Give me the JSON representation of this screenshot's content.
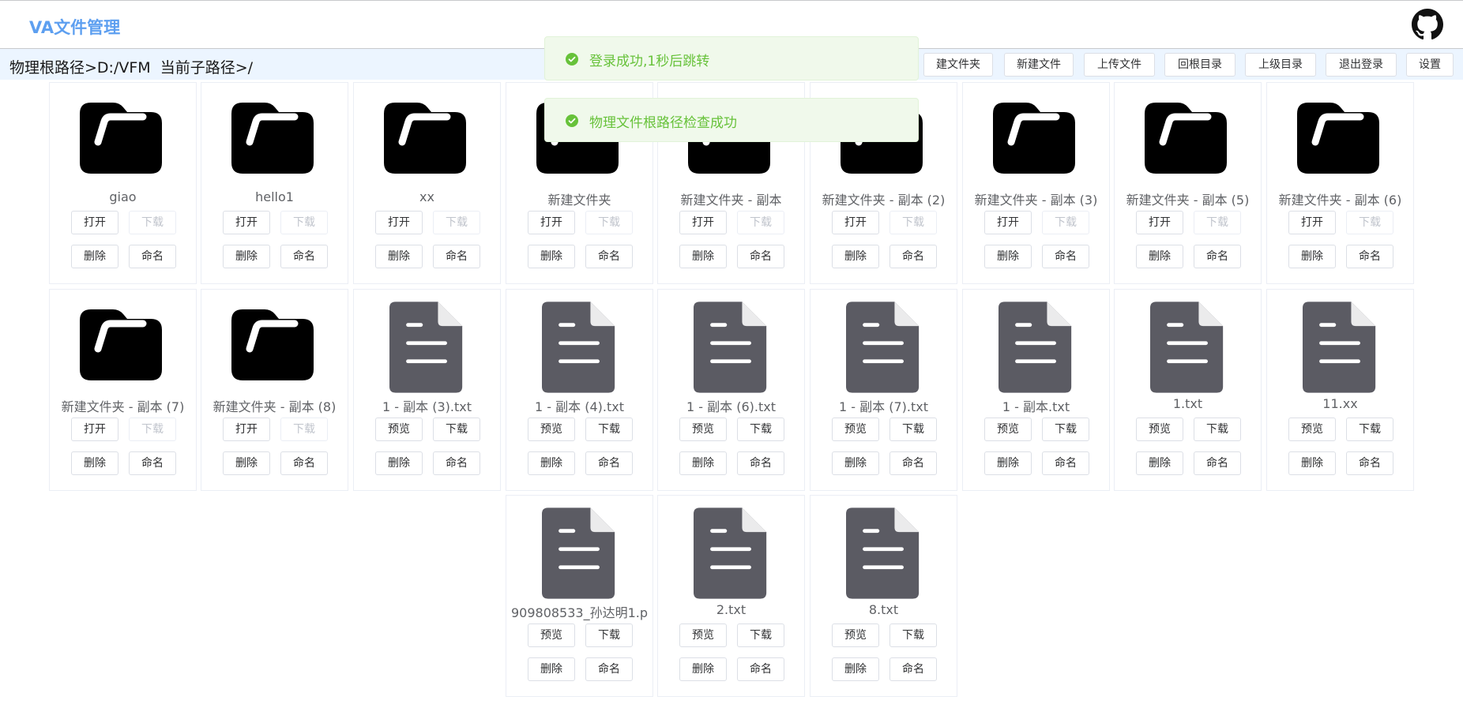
{
  "app": {
    "title": "VA文件管理"
  },
  "header": {
    "github_icon": "github-icon"
  },
  "toolbar": {
    "path": "物理根路径>D:/VFM  当前子路径>/",
    "buttons": [
      "建文件夹",
      "新建文件",
      "上传文件",
      "回根目录",
      "上级目录",
      "退出登录",
      "设置"
    ]
  },
  "toasts": [
    {
      "icon": "check-circle-icon",
      "message": "登录成功,1秒后跳转"
    },
    {
      "icon": "check-circle-icon",
      "message": "物理文件根路径检查成功"
    }
  ],
  "colors": {
    "brand": "#5d9ff0",
    "success": "#67c23a",
    "folder": "#000000",
    "file": "#5b5b63"
  },
  "items": [
    {
      "name": "giao",
      "type": "folder",
      "buttons": [
        "打开",
        "下载",
        "删除",
        "命名"
      ],
      "disabled": [
        false,
        true,
        false,
        false
      ]
    },
    {
      "name": "hello1",
      "type": "folder",
      "buttons": [
        "打开",
        "下载",
        "删除",
        "命名"
      ],
      "disabled": [
        false,
        true,
        false,
        false
      ]
    },
    {
      "name": "xx",
      "type": "folder",
      "buttons": [
        "打开",
        "下载",
        "删除",
        "命名"
      ],
      "disabled": [
        false,
        true,
        false,
        false
      ]
    },
    {
      "name": "新建文件夹",
      "type": "folder",
      "buttons": [
        "打开",
        "下载",
        "删除",
        "命名"
      ],
      "disabled": [
        false,
        true,
        false,
        false
      ]
    },
    {
      "name": "新建文件夹 - 副本",
      "type": "folder",
      "buttons": [
        "打开",
        "下载",
        "删除",
        "命名"
      ],
      "disabled": [
        false,
        true,
        false,
        false
      ]
    },
    {
      "name": "新建文件夹 - 副本 (2)",
      "type": "folder",
      "buttons": [
        "打开",
        "下载",
        "删除",
        "命名"
      ],
      "disabled": [
        false,
        true,
        false,
        false
      ]
    },
    {
      "name": "新建文件夹 - 副本 (3)",
      "type": "folder",
      "buttons": [
        "打开",
        "下载",
        "删除",
        "命名"
      ],
      "disabled": [
        false,
        true,
        false,
        false
      ]
    },
    {
      "name": "新建文件夹 - 副本 (5)",
      "type": "folder",
      "buttons": [
        "打开",
        "下载",
        "删除",
        "命名"
      ],
      "disabled": [
        false,
        true,
        false,
        false
      ]
    },
    {
      "name": "新建文件夹 - 副本 (6)",
      "type": "folder",
      "buttons": [
        "打开",
        "下载",
        "删除",
        "命名"
      ],
      "disabled": [
        false,
        true,
        false,
        false
      ]
    },
    {
      "name": "新建文件夹 - 副本 (7)",
      "type": "folder",
      "buttons": [
        "打开",
        "下载",
        "删除",
        "命名"
      ],
      "disabled": [
        false,
        true,
        false,
        false
      ]
    },
    {
      "name": "新建文件夹 - 副本 (8)",
      "type": "folder",
      "buttons": [
        "打开",
        "下载",
        "删除",
        "命名"
      ],
      "disabled": [
        false,
        true,
        false,
        false
      ]
    },
    {
      "name": "1 - 副本 (3).txt",
      "type": "file",
      "buttons": [
        "预览",
        "下载",
        "删除",
        "命名"
      ],
      "disabled": [
        false,
        false,
        false,
        false
      ]
    },
    {
      "name": "1 - 副本 (4).txt",
      "type": "file",
      "buttons": [
        "预览",
        "下载",
        "删除",
        "命名"
      ],
      "disabled": [
        false,
        false,
        false,
        false
      ]
    },
    {
      "name": "1 - 副本 (6).txt",
      "type": "file",
      "buttons": [
        "预览",
        "下载",
        "删除",
        "命名"
      ],
      "disabled": [
        false,
        false,
        false,
        false
      ]
    },
    {
      "name": "1 - 副本 (7).txt",
      "type": "file",
      "buttons": [
        "预览",
        "下载",
        "删除",
        "命名"
      ],
      "disabled": [
        false,
        false,
        false,
        false
      ]
    },
    {
      "name": "1 - 副本.txt",
      "type": "file",
      "buttons": [
        "预览",
        "下载",
        "删除",
        "命名"
      ],
      "disabled": [
        false,
        false,
        false,
        false
      ]
    },
    {
      "name": "1.txt",
      "type": "file",
      "buttons": [
        "预览",
        "下载",
        "删除",
        "命名"
      ],
      "disabled": [
        false,
        false,
        false,
        false
      ]
    },
    {
      "name": "11.xx",
      "type": "file",
      "buttons": [
        "预览",
        "下载",
        "删除",
        "命名"
      ],
      "disabled": [
        false,
        false,
        false,
        false
      ]
    },
    {
      "name": "909808533_孙达明1.p",
      "type": "file",
      "buttons": [
        "预览",
        "下载",
        "删除",
        "命名"
      ],
      "disabled": [
        false,
        false,
        false,
        false
      ]
    },
    {
      "name": "2.txt",
      "type": "file",
      "buttons": [
        "预览",
        "下载",
        "删除",
        "命名"
      ],
      "disabled": [
        false,
        false,
        false,
        false
      ]
    },
    {
      "name": "8.txt",
      "type": "file",
      "buttons": [
        "预览",
        "下载",
        "删除",
        "命名"
      ],
      "disabled": [
        false,
        false,
        false,
        false
      ]
    }
  ]
}
